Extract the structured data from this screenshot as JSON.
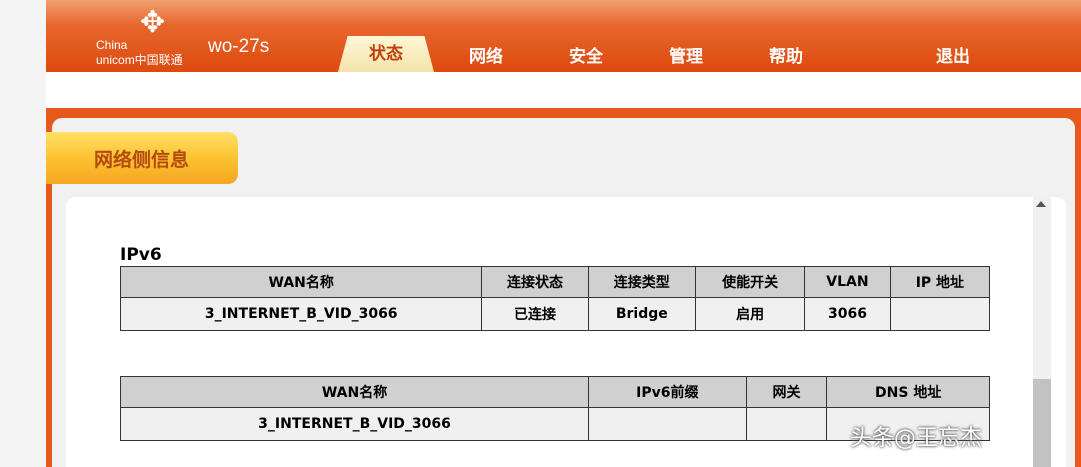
{
  "brand": {
    "logo_line1": "China",
    "logo_line2": "unicom中国联通",
    "model": "wo-27s"
  },
  "nav": {
    "tabs": [
      {
        "label": "状态",
        "active": true
      },
      {
        "label": "网络",
        "active": false
      },
      {
        "label": "安全",
        "active": false
      },
      {
        "label": "管理",
        "active": false
      },
      {
        "label": "帮助",
        "active": false
      },
      {
        "label": "退出",
        "active": false
      }
    ]
  },
  "section": {
    "title": "网络侧信息"
  },
  "ipv6": {
    "label": "IPv6",
    "table1": {
      "headers": [
        "WAN名称",
        "连接状态",
        "连接类型",
        "使能开关",
        "VLAN",
        "IP 地址"
      ],
      "rows": [
        [
          "3_INTERNET_B_VID_3066",
          "已连接",
          "Bridge",
          "启用",
          "3066",
          ""
        ]
      ]
    },
    "table2": {
      "headers": [
        "WAN名称",
        "IPv6前缀",
        "网关",
        "DNS 地址"
      ],
      "rows": [
        [
          "3_INTERNET_B_VID_3066",
          "",
          "",
          ""
        ]
      ]
    }
  },
  "watermark": "头条@王忘杰",
  "colors": {
    "brand_orange": "#dd4a0e",
    "section_yellow": "#fbc02d",
    "header_gray": "#d0d0d0"
  }
}
